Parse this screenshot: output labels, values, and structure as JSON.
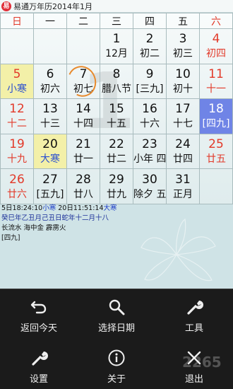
{
  "titlebar": {
    "icon": "calendar-app-icon",
    "title": "易通万年历2014年1月"
  },
  "weekdays": [
    "日",
    "一",
    "二",
    "三",
    "四",
    "五",
    "六"
  ],
  "weeks": [
    [
      {
        "day": "",
        "lunar": ""
      },
      {
        "day": "",
        "lunar": ""
      },
      {
        "day": "",
        "lunar": ""
      },
      {
        "day": "1",
        "lunar": "12月"
      },
      {
        "day": "2",
        "lunar": "初二"
      },
      {
        "day": "3",
        "lunar": "初三"
      },
      {
        "day": "4",
        "lunar": "初四"
      }
    ],
    [
      {
        "day": "5",
        "lunar": "小寒",
        "term": true
      },
      {
        "day": "6",
        "lunar": "初六"
      },
      {
        "day": "7",
        "lunar": "初七",
        "circled": true
      },
      {
        "day": "8",
        "lunar": "腊八节"
      },
      {
        "day": "9",
        "lunar": "[三九]"
      },
      {
        "day": "10",
        "lunar": "初十"
      },
      {
        "day": "11",
        "lunar": "十一"
      }
    ],
    [
      {
        "day": "12",
        "lunar": "十二"
      },
      {
        "day": "13",
        "lunar": "十三"
      },
      {
        "day": "14",
        "lunar": "十四"
      },
      {
        "day": "15",
        "lunar": "十五"
      },
      {
        "day": "16",
        "lunar": "十六"
      },
      {
        "day": "17",
        "lunar": "十七"
      },
      {
        "day": "18",
        "lunar": "[四九]",
        "today": true
      }
    ],
    [
      {
        "day": "19",
        "lunar": "十九"
      },
      {
        "day": "20",
        "lunar": "大寒",
        "term": true
      },
      {
        "day": "21",
        "lunar": "廿一"
      },
      {
        "day": "22",
        "lunar": "廿二"
      },
      {
        "day": "23",
        "lunar": "小年 四"
      },
      {
        "day": "24",
        "lunar": "廿四"
      },
      {
        "day": "25",
        "lunar": "廿五"
      }
    ],
    [
      {
        "day": "26",
        "lunar": "廿六"
      },
      {
        "day": "27",
        "lunar": "[五九]"
      },
      {
        "day": "28",
        "lunar": "廿八"
      },
      {
        "day": "29",
        "lunar": "廿九"
      },
      {
        "day": "30",
        "lunar": "除夕 五"
      },
      {
        "day": "31",
        "lunar": "正月"
      },
      {
        "day": "",
        "lunar": ""
      }
    ]
  ],
  "watermark_digit": "1",
  "info": {
    "line1_a": "5日18:24:10",
    "line1_b": "小寒",
    "line1_c": " 20日11:51:14",
    "line1_d": "大寒",
    "line2": "癸巳年乙丑月己丑日蛇年十二月十八",
    "line3": "长流水 海中金 霹雳火",
    "line4": "[四九]"
  },
  "menu": [
    {
      "label": "返回今天",
      "icon": "return-icon"
    },
    {
      "label": "选择日期",
      "icon": "search-icon"
    },
    {
      "label": "工具",
      "icon": "wrench-icon"
    },
    {
      "label": "设置",
      "icon": "settings-wrench-icon"
    },
    {
      "label": "关于",
      "icon": "info-icon"
    },
    {
      "label": "退出",
      "icon": "close-icon"
    }
  ],
  "corner_watermark": "2265"
}
